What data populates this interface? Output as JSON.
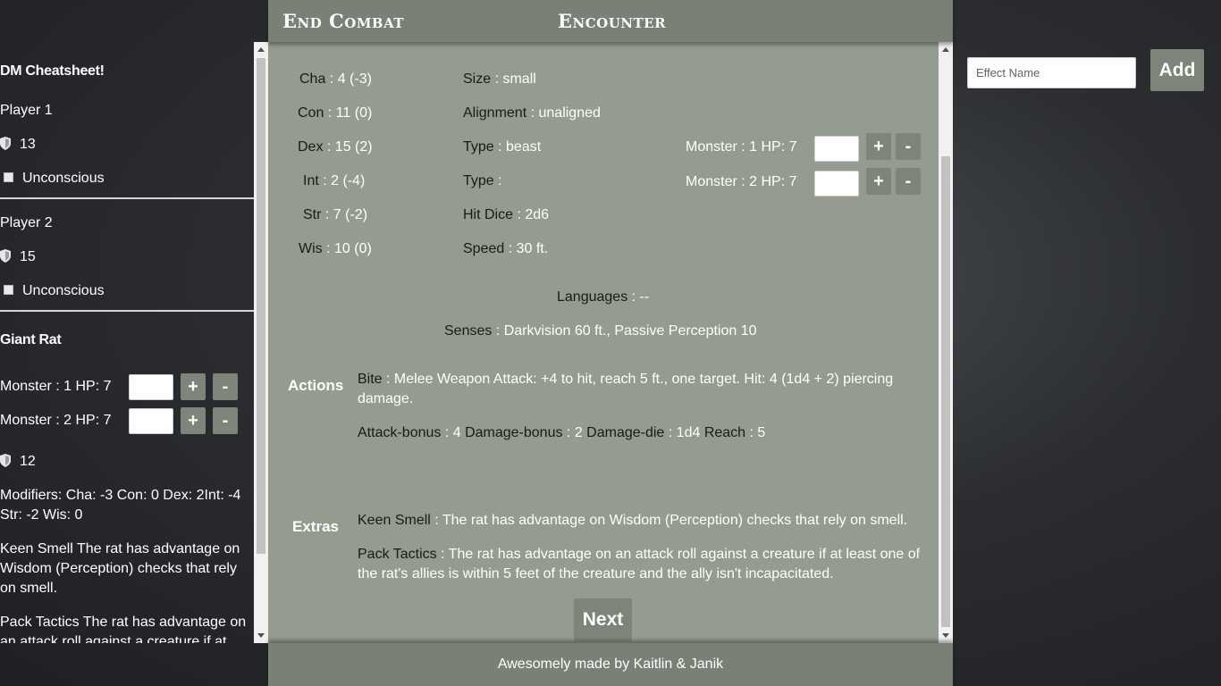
{
  "header": {
    "end_combat": "End Combat",
    "title": "Encounter"
  },
  "sidebar": {
    "title": "DM Cheatsheet!",
    "players": [
      {
        "name": "Player 1",
        "ac": "13",
        "condition": "Unconscious"
      },
      {
        "name": "Player 2",
        "ac": "15",
        "condition": "Unconscious"
      }
    ],
    "monster_group": {
      "name": "Giant Rat",
      "monsters": [
        {
          "label": "Monster : 1 HP: 7"
        },
        {
          "label": "Monster : 2 HP: 7"
        }
      ],
      "ac": "12",
      "modifiers": "Modifiers: Cha: -3 Con: 0 Dex: 2Int: -4 Str: -2 Wis: 0",
      "keen_smell": "Keen Smell The rat has advantage on Wisdom (Perception) checks that rely on smell.",
      "pack_tactics": "Pack Tactics The rat has advantage on an attack roll against a creature if at least one of the rat's allies is within 5 feet of the creature and the ally isn't incapacitated."
    }
  },
  "buttons": {
    "plus": "+",
    "minus": "-",
    "next": "Next",
    "add": "Add"
  },
  "stats": [
    {
      "label": "Cha",
      "value": " : 4 (-3)"
    },
    {
      "label": "Con",
      "value": " : 11 (0)"
    },
    {
      "label": "Dex",
      "value": " : 15 (2)"
    },
    {
      "label": "Int",
      "value": " : 2 (-4)"
    },
    {
      "label": "Str",
      "value": " : 7 (-2)"
    },
    {
      "label": "Wis",
      "value": " : 10 (0)"
    }
  ],
  "info": [
    {
      "label": "Size",
      "value": " : small"
    },
    {
      "label": "Alignment",
      "value": " : unaligned"
    },
    {
      "label": "Type",
      "value": " : beast"
    },
    {
      "label": "Type",
      "value": " :"
    },
    {
      "label": "Hit Dice",
      "value": " : 2d6"
    },
    {
      "label": "Speed",
      "value": " : 30 ft."
    }
  ],
  "monster_hp": [
    {
      "label": "Monster : 1 HP: 7"
    },
    {
      "label": "Monster : 2 HP: 7"
    }
  ],
  "languages": {
    "label": "Languages",
    "value": " : --"
  },
  "senses": {
    "label": "Senses",
    "value": " : Darkvision 60 ft., Passive Perception 10"
  },
  "actions": {
    "section": "Actions",
    "name": "Bite",
    "desc": " : Melee Weapon Attack: +4 to hit, reach 5 ft., one target. Hit: 4 (1d4 + 2) piercing damage.",
    "attack_bonus_label": "Attack-bonus",
    "attack_bonus": " : 4 ",
    "damage_bonus_label": "Damage-bonus",
    "damage_bonus": " : 2 ",
    "damage_die_label": "Damage-die",
    "damage_die": " : 1d4 ",
    "reach_label": "Reach",
    "reach": " : 5"
  },
  "extras": {
    "section": "Extras",
    "items": [
      {
        "name": "Keen Smell",
        "desc": " : The rat has advantage on Wisdom (Perception) checks that rely on smell."
      },
      {
        "name": "Pack Tactics",
        "desc": " : The rat has advantage on an attack roll against a creature if at least one of the rat's allies is within 5 feet of the creature and the ally isn't incapacitated."
      }
    ]
  },
  "effect": {
    "placeholder": "Effect Name"
  },
  "footer": {
    "text": "Awesomely made by Kaitlin & Janik"
  },
  "colors": {
    "panel": "#949b8f",
    "header": "#7a8075",
    "button": "#7e8479"
  }
}
